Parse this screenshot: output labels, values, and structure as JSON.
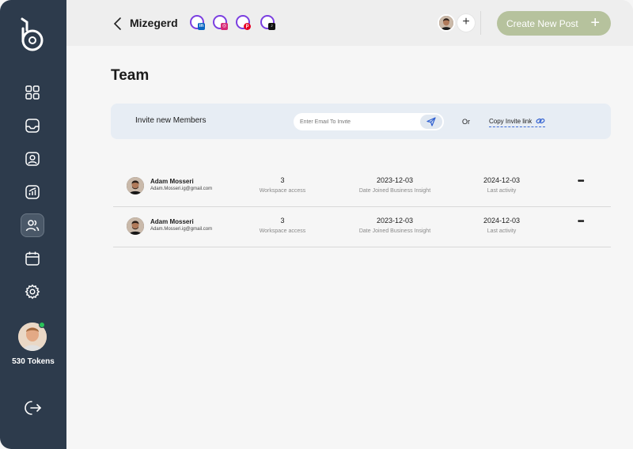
{
  "sidebar": {
    "nav_items": [
      {
        "name": "dashboard",
        "icon": "grid-icon"
      },
      {
        "name": "inbox",
        "icon": "inbox-icon"
      },
      {
        "name": "profile",
        "icon": "user-square-icon"
      },
      {
        "name": "analytics",
        "icon": "chart-icon"
      },
      {
        "name": "team",
        "icon": "users-icon",
        "active": true
      },
      {
        "name": "calendar",
        "icon": "calendar-icon"
      },
      {
        "name": "settings",
        "icon": "gear-icon"
      }
    ],
    "tokens": "530 Tokens",
    "logout_icon": "logout-icon"
  },
  "header": {
    "workspace_name": "Mizegerd",
    "socials": [
      {
        "name": "linkedin",
        "badge": "in",
        "color": "#0a66c2"
      },
      {
        "name": "instagram",
        "badge": "◎",
        "color": "#d62976"
      },
      {
        "name": "pinterest",
        "badge": "p",
        "color": "#e60023"
      },
      {
        "name": "tiktok",
        "badge": "♪",
        "color": "#111111"
      }
    ],
    "add_member": "+",
    "create_button": "Create New Post",
    "create_button_icon": "+"
  },
  "main": {
    "title": "Team",
    "invite": {
      "label": "Invite new Members",
      "placeholder": "Enter Email To Invite",
      "or_text": "Or",
      "copy_link": "Copy Invite link"
    },
    "members": [
      {
        "name": "Adam Mosseri",
        "email": "Adam.Mosseri.ig@gmail.com",
        "workspace_access": "3",
        "workspace_access_label": "Workspace access",
        "date_joined": "2023-12-03",
        "date_joined_label": "Date Joined Business Insight",
        "last_activity": "2024-12-03",
        "last_activity_label": "Last activity",
        "menu": "•••"
      },
      {
        "name": "Adam Mosseri",
        "email": "Adam.Mosseri.ig@gmail.com",
        "workspace_access": "3",
        "workspace_access_label": "Workspace access",
        "date_joined": "2023-12-03",
        "date_joined_label": "Date Joined Business Insight",
        "last_activity": "2024-12-03",
        "last_activity_label": "Last activity",
        "menu": "•••"
      }
    ]
  },
  "colors": {
    "sidebar_bg": "#2d3b4c",
    "accent_green": "#b6c29d",
    "invite_bg": "#e7edf4",
    "social_ring": "#7b3fe0"
  }
}
